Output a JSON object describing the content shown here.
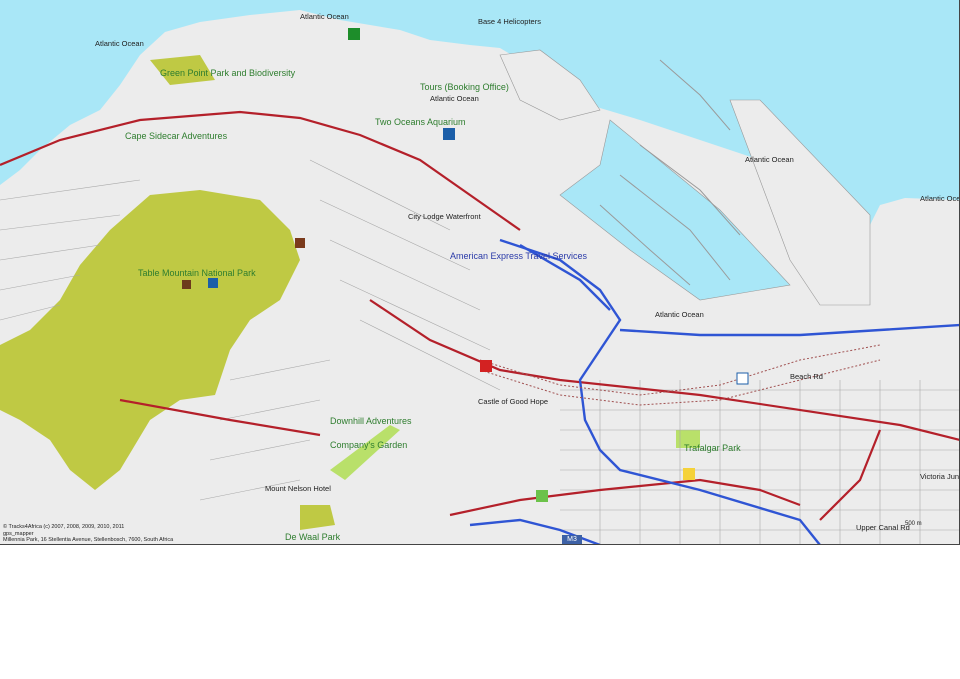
{
  "labels": {
    "ocean_nw": "Atlantic Ocean",
    "ocean_top": "Atlantic Ocean",
    "ocean_harbour": "Atlantic Ocean",
    "ocean_center": "Atlantic Ocean",
    "ocean_east": "Atlantic Ocea",
    "ocean_south": "Atlantic Ocean",
    "helicopters": "Base 4 Helicopters",
    "green_point": "Green Point Park and Biodiversity",
    "booking": "Tours (Booking Office)",
    "aquarium": "Two Oceans Aquarium",
    "cape_sidecar": "Cape Sidecar Adventures",
    "table_mountain": "Table Mountain National Park",
    "city_lodge": "City Lodge Waterfront",
    "amex": "American Express Travel Services",
    "castle": "Castle of Good Hope",
    "downhill": "Downhill Adventures",
    "company_garden": "Company's Garden",
    "mount_nelson": "Mount Nelson Hotel",
    "de_waal": "De Waal Park",
    "trafalgar": "Trafalgar Park",
    "beach_rd": "Beach Rd",
    "upper_canal": "Upper Canal Rd",
    "victoria_junction": "Victoria Junction"
  },
  "credit": {
    "line1": "© Tracks4Africa (c) 2007, 2008, 2009, 2010, 2011",
    "line2": "gps_mapper",
    "line3": "Millennia Park, 16 Stellentia Avenue, Stellenbosch, 7600, South Africa"
  },
  "scale_text": "500 m",
  "road_badge": "M3",
  "colors": {
    "sea": "#a9e7f7",
    "land": "#ececec",
    "park": "#bfc944",
    "major_road": "#b4202a",
    "freeway": "#2f55d4",
    "street": "#a8a8a8"
  }
}
